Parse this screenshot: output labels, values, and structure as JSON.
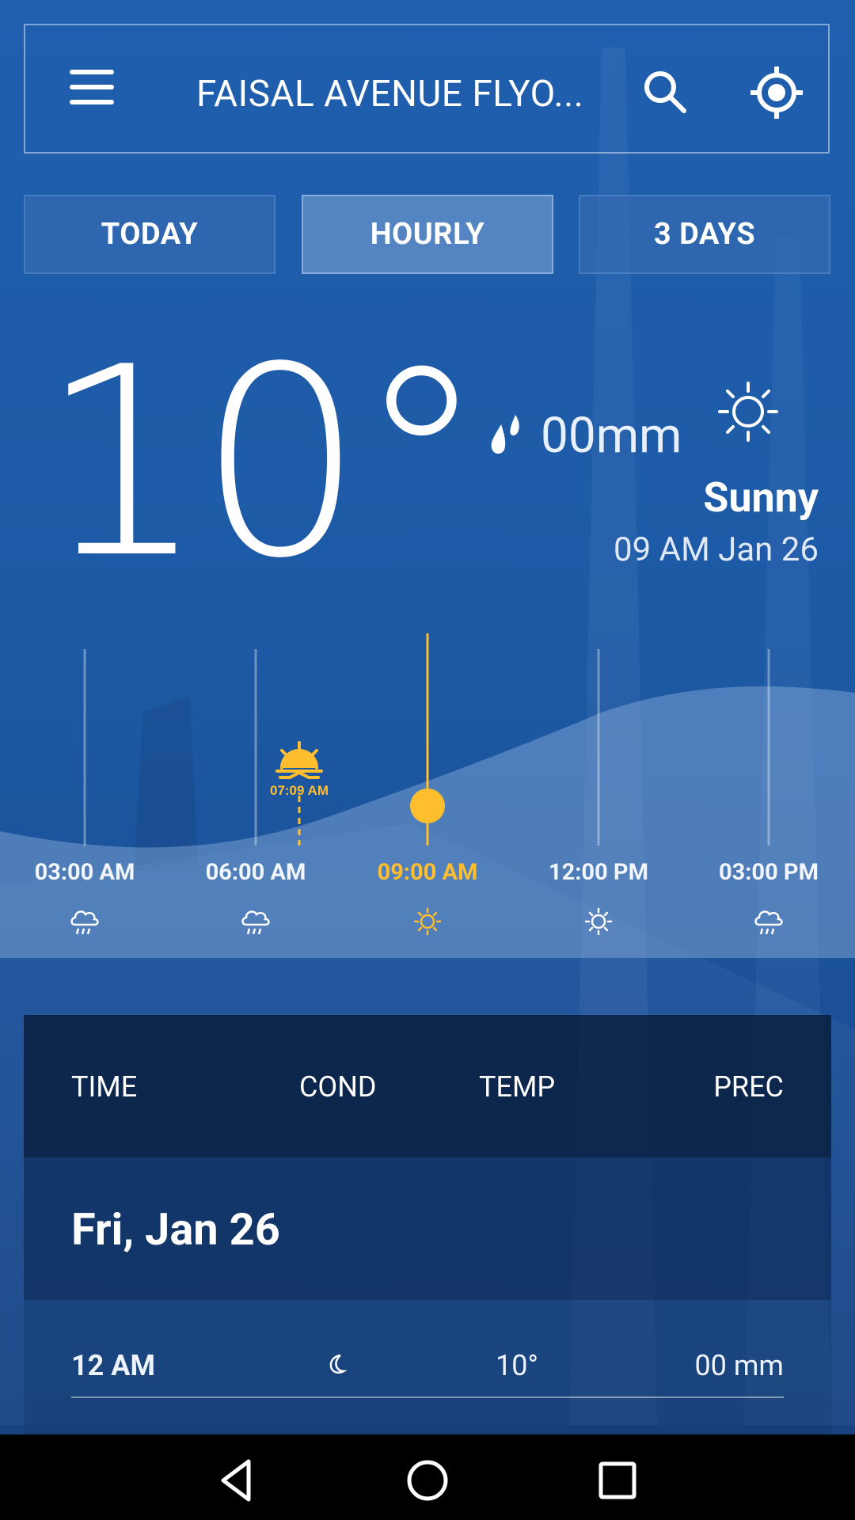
{
  "header": {
    "location": "FAISAL AVENUE FLYO...",
    "menu_icon": "hamburger-menu-icon",
    "search_icon": "search-icon",
    "location_icon": "gps-locate-icon"
  },
  "tabs": [
    {
      "label": "TODAY",
      "active": false
    },
    {
      "label": "HOURLY",
      "active": true
    },
    {
      "label": "3 DAYS",
      "active": false
    }
  ],
  "current": {
    "temperature": "10°",
    "precipitation": "00mm",
    "condition": "Sunny",
    "time": "09 AM Jan 26",
    "condition_icon": "sun-icon",
    "precip_icon": "raindrop-icon"
  },
  "hourly": {
    "sunrise_label": "07:09 AM",
    "hours": [
      {
        "label": "03:00 AM",
        "icon": "cloud-rain-icon",
        "active": false
      },
      {
        "label": "06:00 AM",
        "icon": "cloud-rain-icon",
        "active": false
      },
      {
        "label": "09:00 AM",
        "icon": "sun-icon",
        "active": true
      },
      {
        "label": "12:00 PM",
        "icon": "sun-icon",
        "active": false
      },
      {
        "label": "03:00 PM",
        "icon": "cloud-rain-icon",
        "active": false
      }
    ]
  },
  "table": {
    "headers": {
      "time": "TIME",
      "cond": "COND",
      "temp": "TEMP",
      "prec": "PREC"
    },
    "date": "Fri, Jan 26",
    "rows": [
      {
        "time": "12 AM",
        "cond_icon": "moon-icon",
        "temp": "10°",
        "prec": "00 mm"
      }
    ]
  },
  "colors": {
    "accent": "#ffbe2e",
    "background": "#1d5aa6"
  }
}
